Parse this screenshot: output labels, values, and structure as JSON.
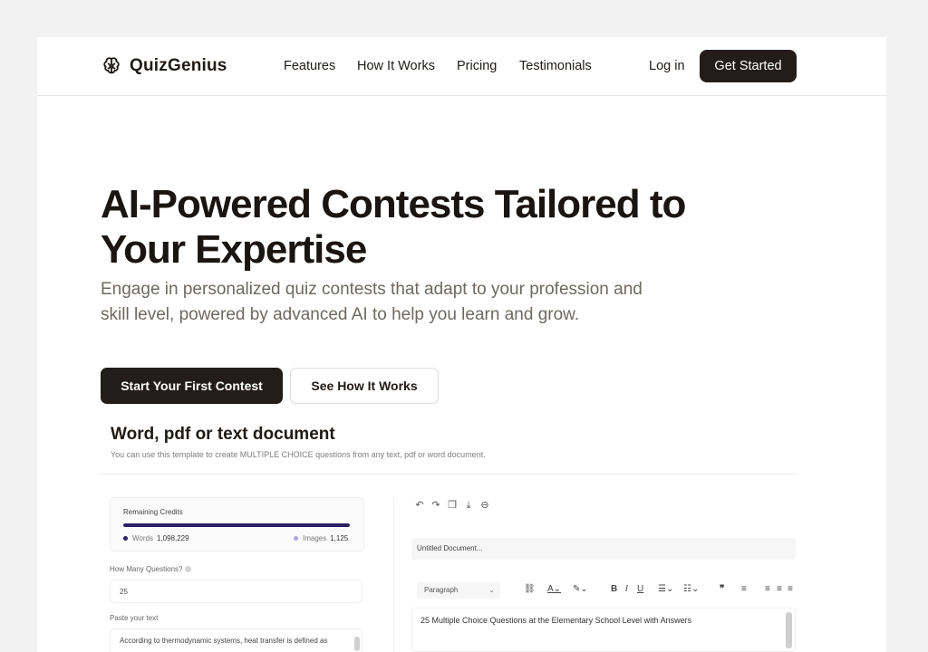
{
  "brand": {
    "name": "QuizGenius",
    "icon": "brain-icon"
  },
  "nav": {
    "links": [
      "Features",
      "How It Works",
      "Pricing",
      "Testimonials"
    ],
    "login_label": "Log in",
    "cta_label": "Get Started"
  },
  "hero": {
    "title_line1": "AI-Powered Contests Tailored to",
    "title_line2": "Your Expertise",
    "subtitle": "Engage in personalized quiz contests that adapt to your profession and skill level, powered by advanced AI to help you learn and grow.",
    "primary_button": "Start Your First Contest",
    "secondary_button": "See How It Works"
  },
  "preview": {
    "title": "Word, pdf or text document",
    "description": "You can use this template to create MULTIPLE CHOICE questions from any text, pdf or word document.",
    "credits": {
      "title": "Remaining Credits",
      "words_label": "Words",
      "words_value": "1,098,229",
      "images_label": "Images",
      "images_value": "1,125",
      "words_fraction": 1.0,
      "words_color": "#2b1f66",
      "images_color": "#a9a3e0"
    },
    "questions_label": "How Many Questions?",
    "questions_value": "25",
    "paste_label": "Paste your text",
    "paste_text": "According to thermodynamic systems, heat transfer is defined as",
    "toolbar_icons": [
      "undo-icon",
      "redo-icon",
      "copy-icon",
      "download-icon",
      "minus-circle-icon"
    ],
    "document_title": "Untitled Document...",
    "format_select": "Paragraph",
    "editor_text": "25 Multiple Choice Questions at the Elementary School Level with Answers"
  },
  "colors": {
    "primary_dark": "#221c1a",
    "page_background": "#f2f2f2",
    "subtitle_gray": "#6e6863"
  }
}
